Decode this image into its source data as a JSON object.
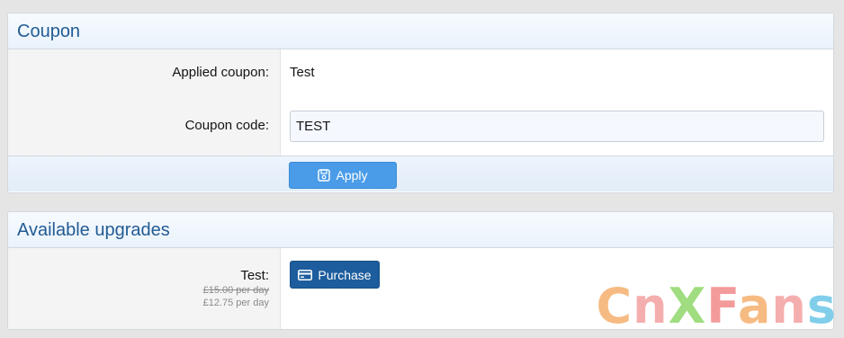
{
  "coupon": {
    "title": "Coupon",
    "applied_label": "Applied coupon:",
    "applied_value": "Test",
    "code_label": "Coupon code:",
    "code_value": "TEST",
    "apply_label": "Apply"
  },
  "upgrades": {
    "title": "Available upgrades",
    "item_name": "Test:",
    "old_price": "£15.00 per day",
    "new_price": "£12.75 per day",
    "purchase_label": "Purchase"
  },
  "watermark": {
    "c": "C",
    "n": "n",
    "x": "X",
    "f": "F",
    "a": "a",
    "n2": "n",
    "s": "s"
  },
  "colors": {
    "header_text": "#225b93",
    "apply_button": "#4a9ce8",
    "purchase_button": "#1d5d9d"
  }
}
